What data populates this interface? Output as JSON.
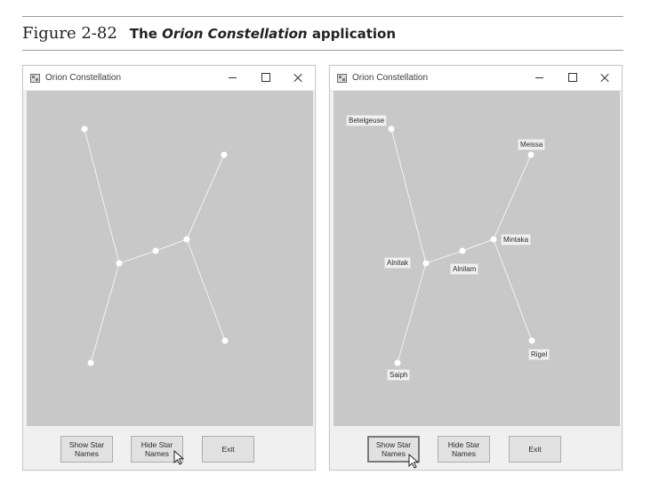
{
  "figure": {
    "number": "Figure 2-82",
    "title_prefix": "The",
    "title_emphasis": "Orion Constellation",
    "title_suffix": "application"
  },
  "app": {
    "window_title": "Orion Constellation",
    "buttons": {
      "show_star_names": "Show Star\nNames",
      "hide_star_names": "Hide Star\nNames",
      "exit": "Exit"
    }
  },
  "stars": {
    "betelgeuse": "Betelgeuse",
    "meissa": "Meissa",
    "mintaka": "Mintaka",
    "alnitak": "Alnitak",
    "alnilam": "Alnilam",
    "rigel": "Rigel",
    "saiph": "Saiph"
  },
  "colors": {
    "canvas": "#c8c8c8",
    "lines": "#f2f2f2",
    "stars": "#ffffff",
    "form": "#f0f0f0"
  }
}
